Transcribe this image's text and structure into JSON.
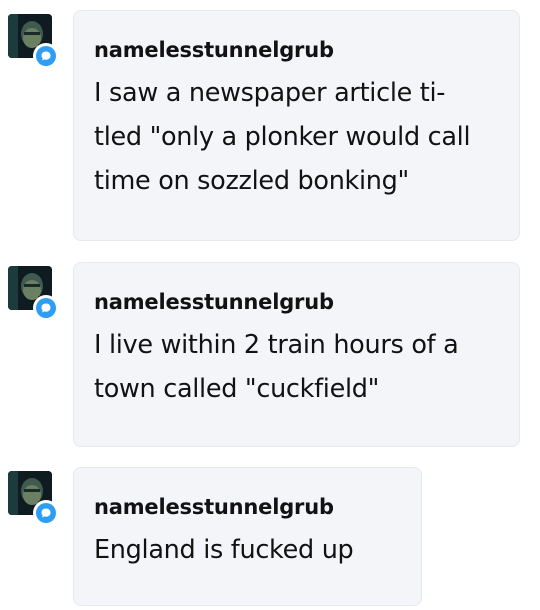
{
  "messages": [
    {
      "username": "namelesstunnelgrub",
      "lines": [
        "I saw a newspaper article ti-",
        "tled \"only a plonker would call",
        "time on sozzled bonking\""
      ]
    },
    {
      "username": "namelesstunnelgrub",
      "lines": [
        "I live within 2 train hours of a",
        "town called \"cuckfield\""
      ]
    },
    {
      "username": "namelesstunnelgrub",
      "lines": [
        "England is fucked up"
      ]
    }
  ],
  "icons": {
    "avatar": "avatar-icon",
    "badge": "chat-bubble-icon"
  },
  "colors": {
    "bubble_bg": "#f3f5f8",
    "badge_blue": "#2e9ef5",
    "text": "#121212"
  }
}
